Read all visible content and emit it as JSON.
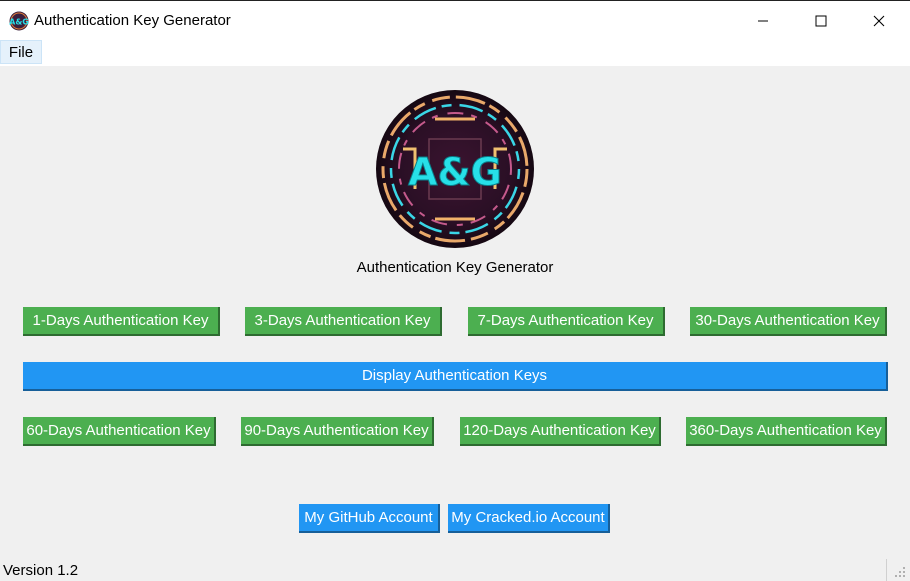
{
  "window": {
    "title": "Authentication Key Generator",
    "controls": [
      "minimize",
      "maximize",
      "close"
    ]
  },
  "menu": {
    "file_label": "File"
  },
  "logo": {
    "text": "A&G",
    "label": "Authentication Key Generator"
  },
  "row1": [
    "1-Days Authentication Key",
    "3-Days Authentication Key",
    "7-Days Authentication Key",
    "30-Days Authentication Key"
  ],
  "display_button": "Display Authentication Keys",
  "row2": [
    "60-Days Authentication Key",
    "90-Days Authentication Key",
    "120-Days Authentication Key",
    "360-Days Authentication Key"
  ],
  "links": {
    "github": "My GitHub Account",
    "cracked": "My Cracked.io Account"
  },
  "status": {
    "version": "Version 1.2"
  },
  "colors": {
    "green": "#4caf50",
    "blue": "#2196f3",
    "background": "#f0f0f0"
  }
}
